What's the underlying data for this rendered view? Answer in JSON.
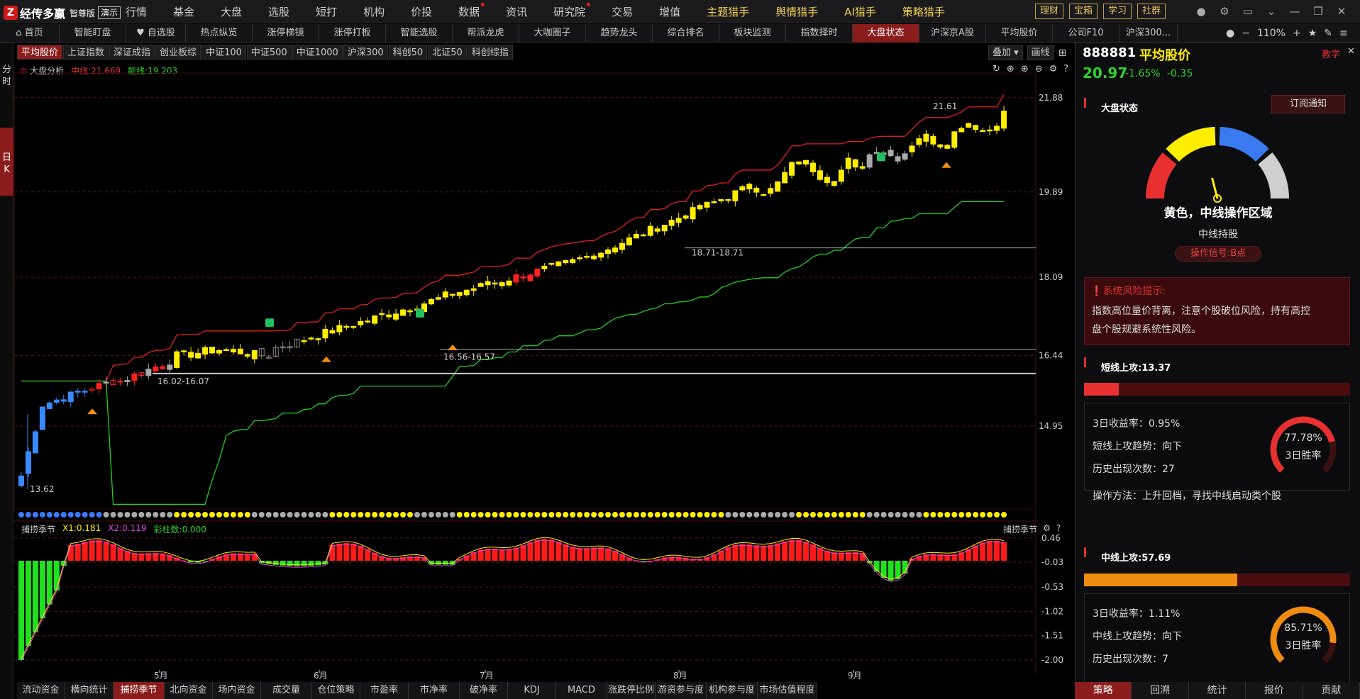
{
  "app": {
    "logo_char": "Z",
    "name": "经传多赢",
    "edition": "智尊版",
    "demo": "演示"
  },
  "top_menu": [
    {
      "label": "行情",
      "hl": false,
      "dot": false
    },
    {
      "label": "基金",
      "hl": false,
      "dot": false
    },
    {
      "label": "大盘",
      "hl": false,
      "dot": false
    },
    {
      "label": "选股",
      "hl": false,
      "dot": false
    },
    {
      "label": "短打",
      "hl": false,
      "dot": false
    },
    {
      "label": "机构",
      "hl": false,
      "dot": false
    },
    {
      "label": "价投",
      "hl": false,
      "dot": false
    },
    {
      "label": "数据",
      "hl": false,
      "dot": true
    },
    {
      "label": "资讯",
      "hl": false,
      "dot": false
    },
    {
      "label": "研究院",
      "hl": false,
      "dot": true
    },
    {
      "label": "交易",
      "hl": false,
      "dot": false
    },
    {
      "label": "增值",
      "hl": false,
      "dot": false
    },
    {
      "label": "主题猎手",
      "hl": true,
      "dot": false
    },
    {
      "label": "舆情猎手",
      "hl": true,
      "dot": false
    },
    {
      "label": "AI猎手",
      "hl": true,
      "dot": false
    },
    {
      "label": "策略猎手",
      "hl": true,
      "dot": false
    }
  ],
  "top_buttons": [
    "理财",
    "宝箱",
    "学习",
    "社群"
  ],
  "window_icons": [
    "user-icon",
    "gear-icon",
    "screen-icon",
    "chevron-down-icon",
    "minimize-icon",
    "restore-icon",
    "close-icon"
  ],
  "tabs": [
    {
      "label": "⌂ 首页",
      "w": 84
    },
    {
      "label": "智能盯盘",
      "w": 94
    },
    {
      "label": "♥ 自选股",
      "w": 84
    },
    {
      "label": "热点纵览",
      "w": 94
    },
    {
      "label": "涨停梯镜",
      "w": 94
    },
    {
      "label": "涨停打板",
      "w": 94
    },
    {
      "label": "智能选股",
      "w": 94
    },
    {
      "label": "帮派龙虎",
      "w": 94
    },
    {
      "label": "大咖圈子",
      "w": 94
    },
    {
      "label": "趋势龙头",
      "w": 94
    },
    {
      "label": "综合排名",
      "w": 94
    },
    {
      "label": "板块监测",
      "w": 94
    },
    {
      "label": "指数择时",
      "w": 94
    },
    {
      "label": "大盘状态",
      "w": 94,
      "active": true
    },
    {
      "label": "沪深京A股",
      "w": 94
    },
    {
      "label": "平均股价",
      "w": 94
    },
    {
      "label": "公司F10",
      "w": 94
    },
    {
      "label": "沪深300...",
      "w": 82
    }
  ],
  "zoom": {
    "minus": "−",
    "level": "110%",
    "plus": "+"
  },
  "left_vertical": [
    {
      "label": "分\n时",
      "active": false
    },
    {
      "label": "日\nK",
      "active": true
    }
  ],
  "index_tabs": [
    "平均股价",
    "上证指数",
    "深证成指",
    "创业板综",
    "中证100",
    "中证500",
    "中证1000",
    "沪深300",
    "科创50",
    "北证50",
    "科创综指"
  ],
  "chart_tools": [
    "叠加 ▾",
    "画线"
  ],
  "legend": {
    "name": "大盘分析",
    "mid": "中线:21.669",
    "low": "能线:19.203"
  },
  "sub_legend": {
    "name": "捕捞季节",
    "x1": "X1:0.181",
    "x2": "X2:0.119",
    "bars": "彩柱数:0.000"
  },
  "sub_right": "捕捞季节",
  "bottom_tabs": [
    "流动资金",
    "横向统计",
    "捕捞季节",
    "北向资金",
    "场内资金",
    "成交量",
    "仓位策略",
    "市盈率",
    "市净率",
    "破净率",
    "KDJ",
    "MACD",
    "涨跌停比例",
    "游资参与度",
    "机构参与度",
    "市场估值程度"
  ],
  "chart_data": {
    "type": "candlestick",
    "y_ticks": [
      "21.88",
      "19.89",
      "18.09",
      "16.44",
      "14.95"
    ],
    "ylim": [
      13.2,
      22.4
    ],
    "months": [
      "5月",
      "6月",
      "7月",
      "8月",
      "9月"
    ],
    "annotations": [
      "16.02-16.07",
      "16.56-16.57",
      "18.71-18.71",
      "13.62",
      "21.61"
    ],
    "sub_ticks": [
      "0.46",
      "-0.03",
      "-0.53",
      "-1.02",
      "-1.51",
      "-2.00"
    ],
    "sub_ylim": [
      -2.2,
      0.8
    ]
  },
  "right_panel": {
    "code": "888881",
    "name": "平均股价",
    "teach": "教学",
    "price": "20.97",
    "change_pct": "-1.65%",
    "change": "-0.35",
    "state_title": "大盘状态",
    "subscribe": "订阅通知",
    "gauge_value": 0.42,
    "state_text": "黄色，中线操作区域",
    "state_sub": "中线持股",
    "signal": "操作信号:B点",
    "risk_title": "系统风险提示:",
    "risk_text_1": "指数高位量价背离，注意个股破位风险，持有高控",
    "risk_text_2": "盘个股规避系统性风险。",
    "short": {
      "title": "短线上攻:13.37",
      "fill": 0.13,
      "r1": "3日收益率：0.95%",
      "r2": "短线上攻趋势：向下",
      "r3": "历史出现次数：27",
      "r4": "操作方法：上升回档，寻找中线启动类个股",
      "pct": "77.78%",
      "pct_val": 0.7778,
      "pct_label": "3日胜率"
    },
    "mid": {
      "title": "中线上攻:57.69",
      "fill": 0.5769,
      "r1": "3日收益率：1.11%",
      "r2": "中线上攻趋势：向下",
      "r3": "历史出现次数：7",
      "pct": "85.71%",
      "pct_val": 0.8571,
      "pct_label": "3日胜率"
    },
    "bottom_tabs": [
      "策略",
      "回溯",
      "统计",
      "报价",
      "贡献"
    ]
  },
  "colors": {
    "accent": "#8a1c1c",
    "yellow": "#ffee00",
    "red": "#e02020",
    "green": "#20d020"
  }
}
